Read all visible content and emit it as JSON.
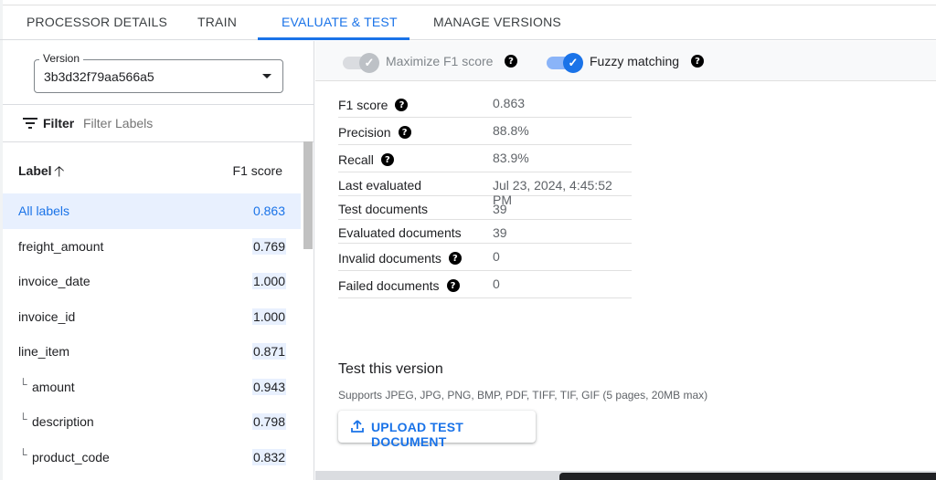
{
  "tabs": [
    {
      "label": "PROCESSOR DETAILS"
    },
    {
      "label": "TRAIN"
    },
    {
      "label": "EVALUATE & TEST"
    },
    {
      "label": "MANAGE VERSIONS"
    }
  ],
  "active_tab": "EVALUATE & TEST",
  "version": {
    "label": "Version",
    "value": "3b3d32f79aa566a5"
  },
  "filter": {
    "label": "Filter",
    "placeholder": "Filter Labels"
  },
  "labels_table": {
    "header_label": "Label",
    "sort_icon": "arrow-up-icon",
    "header_score": "F1 score",
    "rows": [
      {
        "label": "All labels",
        "score": "0.863",
        "child": false,
        "selected": true
      },
      {
        "label": "freight_amount",
        "score": "0.769",
        "child": false,
        "selected": false
      },
      {
        "label": "invoice_date",
        "score": "1.000",
        "child": false,
        "selected": false
      },
      {
        "label": "invoice_id",
        "score": "1.000",
        "child": false,
        "selected": false
      },
      {
        "label": "line_item",
        "score": "0.871",
        "child": false,
        "selected": false
      },
      {
        "label": "amount",
        "score": "0.943",
        "child": true,
        "selected": false
      },
      {
        "label": "description",
        "score": "0.798",
        "child": true,
        "selected": false
      },
      {
        "label": "product_code",
        "score": "0.832",
        "child": true,
        "selected": false
      }
    ]
  },
  "toggles": {
    "maximize": {
      "label": "Maximize F1 score",
      "on": false
    },
    "fuzzy": {
      "label": "Fuzzy matching",
      "on": true
    }
  },
  "stats": [
    {
      "key": "F1 score",
      "value": "0.863",
      "help": true
    },
    {
      "key": "Precision",
      "value": "88.8%",
      "help": true
    },
    {
      "key": "Recall",
      "value": "83.9%",
      "help": true
    },
    {
      "key": "Last evaluated",
      "value": "Jul 23, 2024, 4:45:52 PM",
      "help": false
    },
    {
      "key": "Test documents",
      "value": "39",
      "help": false
    },
    {
      "key": "Evaluated documents",
      "value": "39",
      "help": false
    },
    {
      "key": "Invalid documents",
      "value": "0",
      "help": true
    },
    {
      "key": "Failed documents",
      "value": "0",
      "help": true
    }
  ],
  "test_version": {
    "title": "Test this version",
    "subtitle": "Supports JPEG, JPG, PNG, BMP, PDF, TIFF, TIF, GIF (5 pages, 20MB max)",
    "button": "UPLOAD TEST DOCUMENT"
  },
  "colors": {
    "accent": "#1a73e8",
    "selected_row_bg": "#e8f0fe"
  }
}
